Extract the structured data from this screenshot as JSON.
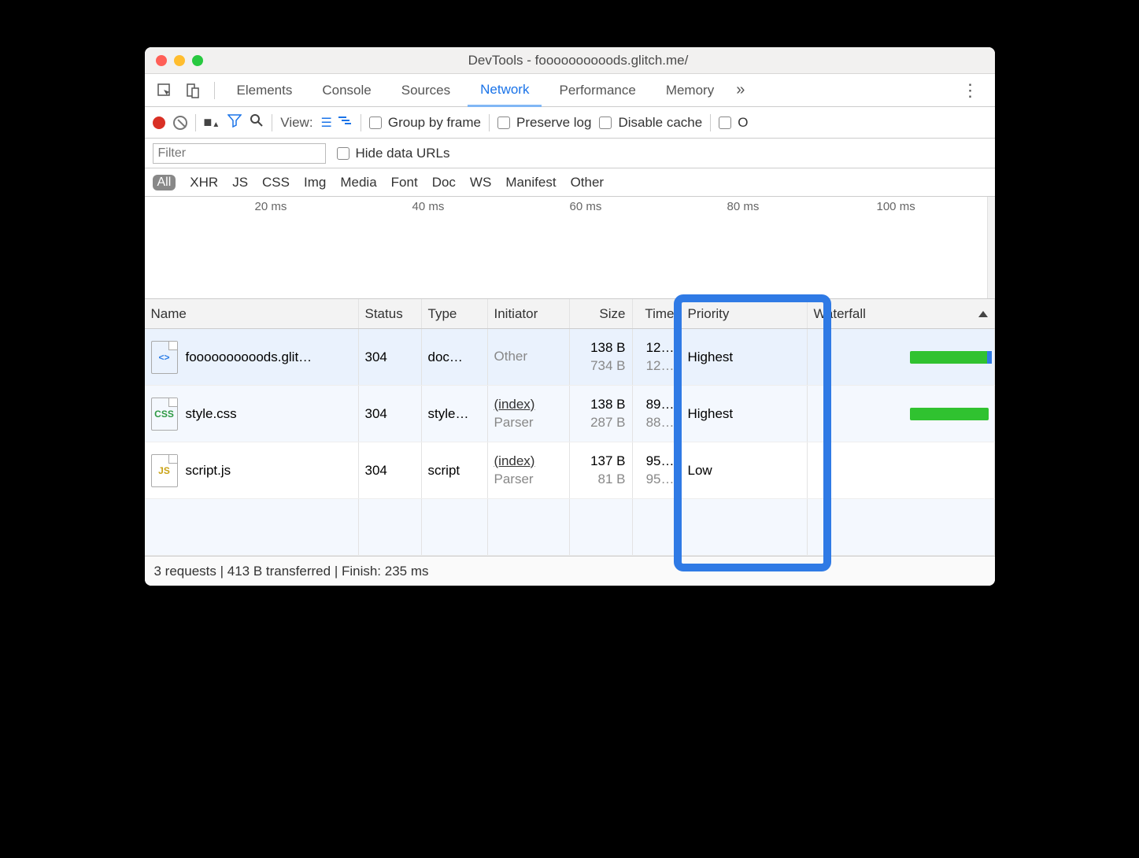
{
  "window": {
    "title": "DevTools - foooooooooods.glitch.me/"
  },
  "tabs": {
    "elements": "Elements",
    "console": "Console",
    "sources": "Sources",
    "network": "Network",
    "performance": "Performance",
    "memory": "Memory"
  },
  "toolbar": {
    "view_label": "View:",
    "group_by_frame": "Group by frame",
    "preserve_log": "Preserve log",
    "disable_cache": "Disable cache",
    "offline_cut": "O"
  },
  "filter": {
    "placeholder": "Filter",
    "hide_data_urls": "Hide data URLs"
  },
  "types": {
    "all": "All",
    "xhr": "XHR",
    "js": "JS",
    "css": "CSS",
    "img": "Img",
    "media": "Media",
    "font": "Font",
    "doc": "Doc",
    "ws": "WS",
    "manifest": "Manifest",
    "other": "Other"
  },
  "ruler": {
    "ticks": [
      "20 ms",
      "40 ms",
      "60 ms",
      "80 ms",
      "100 ms"
    ]
  },
  "columns": {
    "name": "Name",
    "status": "Status",
    "type": "Type",
    "initiator": "Initiator",
    "size": "Size",
    "time": "Time",
    "priority": "Priority",
    "waterfall": "Waterfall"
  },
  "rows": [
    {
      "name": "foooooooooods.glit…",
      "status": "304",
      "type": "doc…",
      "init_top": "Other",
      "init_bottom": "",
      "size_top": "138 B",
      "size_bottom": "734 B",
      "time_top": "12…",
      "time_bottom": "12…",
      "priority": "Highest"
    },
    {
      "name": "style.css",
      "status": "304",
      "type": "style…",
      "init_top": "(index)",
      "init_bottom": "Parser",
      "size_top": "138 B",
      "size_bottom": "287 B",
      "time_top": "89…",
      "time_bottom": "88…",
      "priority": "Highest"
    },
    {
      "name": "script.js",
      "status": "304",
      "type": "script",
      "init_top": "(index)",
      "init_bottom": "Parser",
      "size_top": "137 B",
      "size_bottom": "81 B",
      "time_top": "95…",
      "time_bottom": "95…",
      "priority": "Low"
    }
  ],
  "status": "3 requests | 413 B transferred | Finish: 235 ms"
}
